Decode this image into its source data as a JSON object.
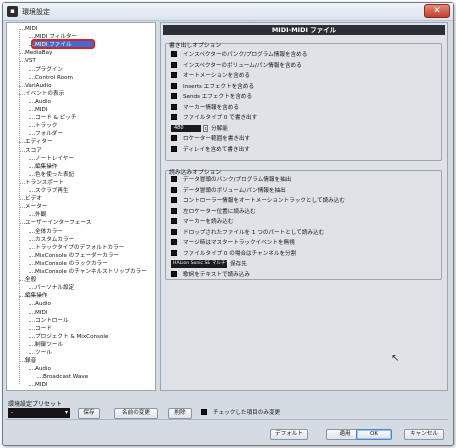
{
  "window": {
    "title": "環境設定",
    "close_glyph": "✕"
  },
  "tree": {
    "items": [
      {
        "label": "MIDI",
        "indent": 0
      },
      {
        "label": "MIDI フィルター",
        "indent": 1
      },
      {
        "label": "MIDI ファイル",
        "indent": 1,
        "selected": true
      },
      {
        "label": "MediaBay",
        "indent": 0
      },
      {
        "label": "VST",
        "indent": 0
      },
      {
        "label": "プラグイン",
        "indent": 1
      },
      {
        "label": "Control Room",
        "indent": 1
      },
      {
        "label": "VariAudio",
        "indent": 0
      },
      {
        "label": "イベントの表示",
        "indent": 0
      },
      {
        "label": "Audio",
        "indent": 1
      },
      {
        "label": "MIDI",
        "indent": 1
      },
      {
        "label": "コード & ピッチ",
        "indent": 1
      },
      {
        "label": "トラック",
        "indent": 1
      },
      {
        "label": "フォルダー",
        "indent": 1
      },
      {
        "label": "エディター",
        "indent": 0
      },
      {
        "label": "スコア",
        "indent": 0
      },
      {
        "label": "ノートレイヤー",
        "indent": 1
      },
      {
        "label": "編集操作",
        "indent": 1
      },
      {
        "label": "色を使った表記",
        "indent": 1
      },
      {
        "label": "トランスポート",
        "indent": 0
      },
      {
        "label": "スクラブ再生",
        "indent": 1
      },
      {
        "label": "ビデオ",
        "indent": 0
      },
      {
        "label": "メーター",
        "indent": 0
      },
      {
        "label": "外観",
        "indent": 1
      },
      {
        "label": "ユーザーインターフェース",
        "indent": 0
      },
      {
        "label": "全体カラー",
        "indent": 1
      },
      {
        "label": "カスタムカラー",
        "indent": 1
      },
      {
        "label": "トラックタイプのデフォルトカラー",
        "indent": 1
      },
      {
        "label": "MixConsole のフェーダーカラー",
        "indent": 1
      },
      {
        "label": "MixConsole のラックカラー",
        "indent": 1
      },
      {
        "label": "MixConsole のチャンネルストリップカラー",
        "indent": 1
      },
      {
        "label": "全般",
        "indent": 0
      },
      {
        "label": "パーソナル設定",
        "indent": 1
      },
      {
        "label": "編集操作",
        "indent": 0
      },
      {
        "label": "Audio",
        "indent": 1
      },
      {
        "label": "MIDI",
        "indent": 1
      },
      {
        "label": "コントロール",
        "indent": 1
      },
      {
        "label": "コード",
        "indent": 1
      },
      {
        "label": "プロジェクト & MixConsole",
        "indent": 1
      },
      {
        "label": "制御ツール",
        "indent": 1
      },
      {
        "label": "ツール",
        "indent": 1
      },
      {
        "label": "録音",
        "indent": 0
      },
      {
        "label": "Audio",
        "indent": 1
      },
      {
        "label": "Broadcast Wave",
        "indent": 2
      },
      {
        "label": "MIDI",
        "indent": 1
      }
    ]
  },
  "panel": {
    "header": "MIDI-MIDI ファイル",
    "export_group": {
      "title": "書き出しオプション",
      "options": [
        {
          "label": "インスペクターのパンク/プログラム情報を含める"
        },
        {
          "label": "インスペクターのボリューム/パン情報を含める"
        },
        {
          "label": "オートメーションを含める"
        },
        {
          "label": "Inserts エフェクトを含める"
        },
        {
          "label": "Sends エフェクトを含める"
        },
        {
          "label": "マーカー情報を含める"
        },
        {
          "label": "ファイルタイプ 0 で書き出す"
        }
      ],
      "resolution": {
        "value": "480",
        "label": "分解能"
      },
      "options_after": [
        {
          "label": "ロケーター範囲を書き出す"
        },
        {
          "label": "ディレイを含めて書き出す"
        }
      ]
    },
    "import_group": {
      "title": "読み込みオプション",
      "options": [
        {
          "label": "データ冒頭のバンク/プログラム情報を抽出"
        },
        {
          "label": "データ冒頭のボリューム/パン情報を抽出"
        },
        {
          "label": "コントローラー情報をオートメーショントラックとして読み込む"
        },
        {
          "label": "左ロケーター位置に読み込む"
        },
        {
          "label": "マーカーを読み込む"
        },
        {
          "label": "ドロップされたファイルを 1 つのパートとして読み込む"
        },
        {
          "label": "マージ時はマスタートラックイベントを無視"
        },
        {
          "label": "ファイルタイプ 0 の場合はチャンネルを分割"
        }
      ],
      "destination": {
        "value": "HALion Sonic SE マルチティンバー",
        "label": "保存先"
      },
      "options_after": [
        {
          "label": "歌詞をテキストで読み込み"
        }
      ]
    }
  },
  "bottom": {
    "preset_label": "環境設定プリセット",
    "preset_value": "-",
    "save": "保存",
    "rename": "名前の変更",
    "delete": "削除",
    "only_changed": "チェックした項目のみ変更",
    "defaults": "デフォルト",
    "apply": "適用",
    "ok": "OK",
    "cancel": "キャンセル"
  }
}
